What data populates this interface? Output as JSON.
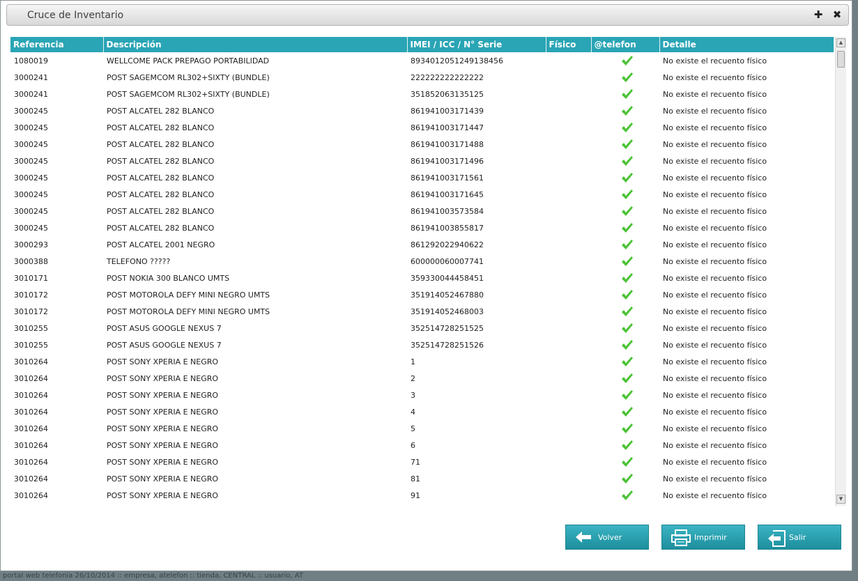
{
  "dialog": {
    "title": "Cruce de Inventario",
    "maximize_glyph": "✚",
    "close_glyph": "✖"
  },
  "table": {
    "columns": [
      "Referencia",
      "Descripción",
      "IMEI / ICC / N° Serie",
      "Físico",
      "@telefon",
      "Detalle"
    ],
    "rows": [
      [
        "1080019",
        "WELLCOME PACK PREPAGO PORTABILIDAD",
        "8934012051249138456",
        "",
        "check",
        "No existe el recuento físico"
      ],
      [
        "3000241",
        "POST SAGEMCOM RL302+SIXTY (BUNDLE)",
        "222222222222222",
        "",
        "check",
        "No existe el recuento físico"
      ],
      [
        "3000241",
        "POST SAGEMCOM RL302+SIXTY (BUNDLE)",
        "351852063135125",
        "",
        "check",
        "No existe el recuento físico"
      ],
      [
        "3000245",
        "POST ALCATEL 282 BLANCO",
        "861941003171439",
        "",
        "check",
        "No existe el recuento físico"
      ],
      [
        "3000245",
        "POST ALCATEL 282 BLANCO",
        "861941003171447",
        "",
        "check",
        "No existe el recuento físico"
      ],
      [
        "3000245",
        "POST ALCATEL 282 BLANCO",
        "861941003171488",
        "",
        "check",
        "No existe el recuento físico"
      ],
      [
        "3000245",
        "POST ALCATEL 282 BLANCO",
        "861941003171496",
        "",
        "check",
        "No existe el recuento físico"
      ],
      [
        "3000245",
        "POST ALCATEL 282 BLANCO",
        "861941003171561",
        "",
        "check",
        "No existe el recuento físico"
      ],
      [
        "3000245",
        "POST ALCATEL 282 BLANCO",
        "861941003171645",
        "",
        "check",
        "No existe el recuento físico"
      ],
      [
        "3000245",
        "POST ALCATEL 282 BLANCO",
        "861941003573584",
        "",
        "check",
        "No existe el recuento físico"
      ],
      [
        "3000245",
        "POST ALCATEL 282 BLANCO",
        "861941003855817",
        "",
        "check",
        "No existe el recuento físico"
      ],
      [
        "3000293",
        "POST ALCATEL 2001 NEGRO",
        "861292022940622",
        "",
        "check",
        "No existe el recuento físico"
      ],
      [
        "3000388",
        "TELEFONO ?????",
        "600000060007741",
        "",
        "check",
        "No existe el recuento físico"
      ],
      [
        "3010171",
        "POST NOKIA 300 BLANCO UMTS",
        "359330044458451",
        "",
        "check",
        "No existe el recuento físico"
      ],
      [
        "3010172",
        "POST MOTOROLA DEFY MINI NEGRO UMTS",
        "351914052467880",
        "",
        "check",
        "No existe el recuento físico"
      ],
      [
        "3010172",
        "POST MOTOROLA DEFY MINI NEGRO UMTS",
        "351914052468003",
        "",
        "check",
        "No existe el recuento físico"
      ],
      [
        "3010255",
        "POST ASUS GOOGLE NEXUS 7",
        "352514728251525",
        "",
        "check",
        "No existe el recuento físico"
      ],
      [
        "3010255",
        "POST ASUS GOOGLE NEXUS 7",
        "352514728251526",
        "",
        "check",
        "No existe el recuento físico"
      ],
      [
        "3010264",
        "POST SONY XPERIA E NEGRO",
        "1",
        "",
        "check",
        "No existe el recuento físico"
      ],
      [
        "3010264",
        "POST SONY XPERIA E NEGRO",
        "2",
        "",
        "check",
        "No existe el recuento físico"
      ],
      [
        "3010264",
        "POST SONY XPERIA E NEGRO",
        "3",
        "",
        "check",
        "No existe el recuento físico"
      ],
      [
        "3010264",
        "POST SONY XPERIA E NEGRO",
        "4",
        "",
        "check",
        "No existe el recuento físico"
      ],
      [
        "3010264",
        "POST SONY XPERIA E NEGRO",
        "5",
        "",
        "check",
        "No existe el recuento físico"
      ],
      [
        "3010264",
        "POST SONY XPERIA E NEGRO",
        "6",
        "",
        "check",
        "No existe el recuento físico"
      ],
      [
        "3010264",
        "POST SONY XPERIA E NEGRO",
        "71",
        "",
        "check",
        "No existe el recuento físico"
      ],
      [
        "3010264",
        "POST SONY XPERIA E NEGRO",
        "81",
        "",
        "check",
        "No existe el recuento físico"
      ],
      [
        "3010264",
        "POST SONY XPERIA E NEGRO",
        "91",
        "",
        "check",
        "No existe el recuento físico"
      ]
    ]
  },
  "buttons": {
    "volver": "Volver",
    "imprimir": "Imprimir",
    "salir": "Salir"
  },
  "footer": "portal web telefonia 26/10/2014 :: empresa, atelefon :: tienda, CENTRAL :: usuario, AT",
  "colors": {
    "header_bg": "#2aa5b5",
    "check": "#4cc236",
    "button_bg": "#2aa5b5"
  }
}
